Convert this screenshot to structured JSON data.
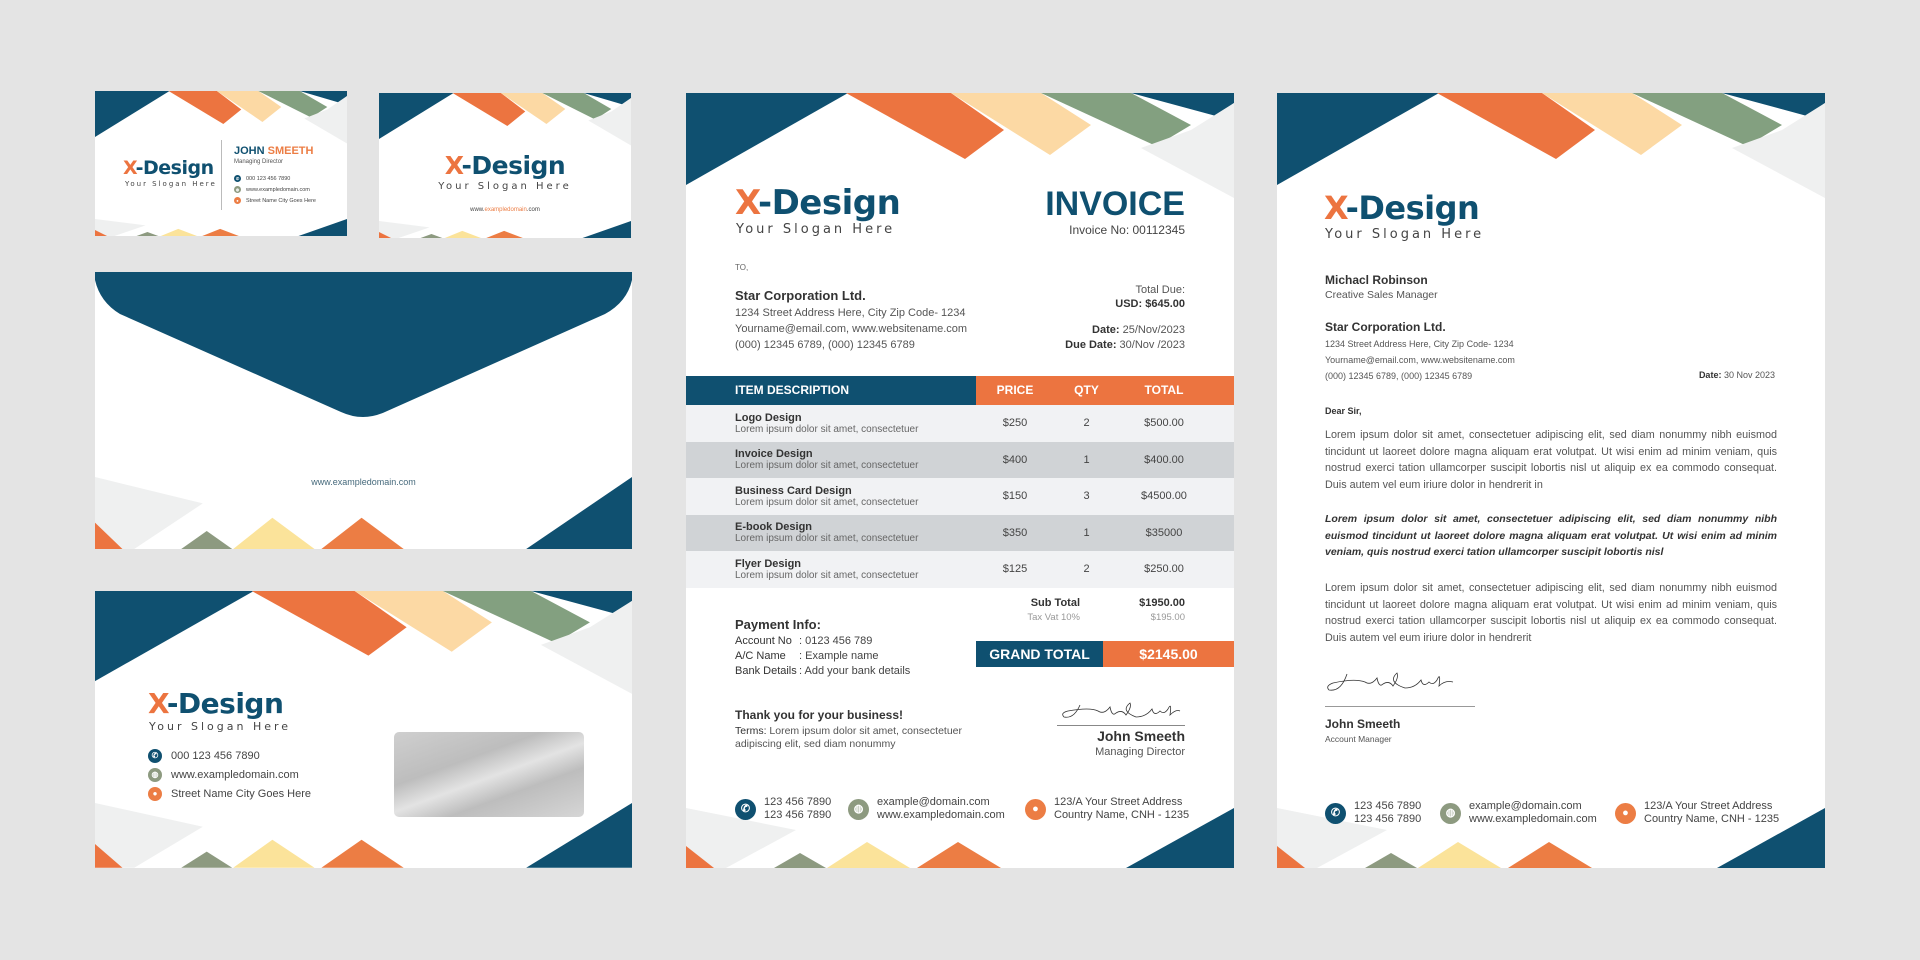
{
  "brand": {
    "logo_prefix": "X",
    "logo_rest": "-Design",
    "slogan": "Your Slogan Here",
    "colors": {
      "navy": "#0f5070",
      "orange": "#ec7440",
      "peach": "#fcd9a4",
      "sage": "#83a080",
      "light_gray": "#eff0f0",
      "yellow": "#fbe39a"
    }
  },
  "business_card_front": {
    "first_name": "JOHN",
    "last_name": "SMEETH",
    "role": "Managing Director",
    "contacts": [
      {
        "icon": "phone-icon",
        "text": "000 123 456 7890"
      },
      {
        "icon": "globe-icon",
        "text": "www.exampledomain.com"
      },
      {
        "icon": "location-pin-icon",
        "text": "Street Name City Goes Here"
      }
    ]
  },
  "business_card_back": {
    "web_prefix": "www.",
    "web_domain": "exampledomain",
    "web_suffix": ".com"
  },
  "envelope_back": {
    "website": "www.exampledomain.com"
  },
  "envelope_front": {
    "contacts": [
      {
        "icon": "phone-icon",
        "text": "000 123 456 7890"
      },
      {
        "icon": "globe-icon",
        "text": "www.exampledomain.com"
      },
      {
        "icon": "location-pin-icon",
        "text": "Street Name City Goes Here"
      }
    ]
  },
  "invoice": {
    "title": "INVOICE",
    "invoice_no": "Invoice No: 00112345",
    "to_label": "TO,",
    "bill_to": {
      "name": "Star Corporation Ltd.",
      "lines": [
        "1234 Street Address Here, City Zip Code- 1234",
        "Yourname@email.com, www.websitename.com",
        "(000) 12345 6789, (000) 12345 6789"
      ]
    },
    "total_due_label": "Total Due:",
    "total_due_value": "USD: $645.00",
    "date_label": "Date:",
    "date_value": " 25/Nov/2023",
    "due_date_label": "Due Date:",
    "due_date_value": " 30/Nov /2023",
    "table": {
      "headers": {
        "description": "ITEM DESCRIPTION",
        "price": "PRICE",
        "qty": "QTY",
        "total": "TOTAL"
      },
      "rows": [
        {
          "title": "Logo Design",
          "subtitle": "Lorem ipsum dolor sit amet, consectetuer",
          "price": "$250",
          "qty": "2",
          "total": "$500.00"
        },
        {
          "title": "Invoice Design",
          "subtitle": "Lorem ipsum dolor sit amet, consectetuer",
          "price": "$400",
          "qty": "1",
          "total": "$400.00"
        },
        {
          "title": "Business Card Design",
          "subtitle": "Lorem ipsum dolor sit amet, consectetuer",
          "price": "$150",
          "qty": "3",
          "total": "$4500.00"
        },
        {
          "title": "E-book Design",
          "subtitle": "Lorem ipsum dolor sit amet, consectetuer",
          "price": "$350",
          "qty": "1",
          "total": "$35000"
        },
        {
          "title": "Flyer Design",
          "subtitle": "Lorem ipsum dolor sit amet, consectetuer",
          "price": "$125",
          "qty": "2",
          "total": "$250.00"
        }
      ]
    },
    "sub_total_label": "Sub Total",
    "sub_total_value": "$1950.00",
    "tax_label": "Tax Vat 10%",
    "tax_value": "$195.00",
    "grand_total_label": "GRAND  TOTAL",
    "grand_total_value": "$2145.00",
    "payment": {
      "title": "Payment Info:",
      "rows": [
        {
          "key": "Account No",
          "value": " : 0123 456 789"
        },
        {
          "key": "A/C Name",
          "value": "    : Example name"
        },
        {
          "key": "Bank Details",
          "value": " : Add your bank details"
        }
      ]
    },
    "thanks": "Thank you for your business!",
    "terms_label": "Terms:",
    "terms_text": " Lorem ipsum dolor sit amet, consectetuer adipiscing elit, sed diam nonummy",
    "signer_name": "John Smeeth",
    "signer_role": "Managing Director",
    "footer": [
      {
        "icon": "phone-icon",
        "lines": [
          "123 456 7890",
          "123 456 7890"
        ]
      },
      {
        "icon": "globe-icon",
        "lines": [
          "example@domain.com",
          "www.exampledomain.com"
        ]
      },
      {
        "icon": "location-pin-icon",
        "lines": [
          "123/A  Your Street Address",
          "Country Name, CNH - 1235"
        ]
      }
    ]
  },
  "letterhead": {
    "recipient_name": "Michacl Robinson",
    "recipient_role": "Creative  Sales Manager",
    "company_name": "Star Corporation Ltd.",
    "company_lines": [
      "1234 Street Address Here, City Zip Code- 1234",
      "Yourname@email.com, www.websitename.com",
      "(000) 12345 6789, (000) 12345 6789"
    ],
    "date_label": "Date:",
    "date_value": " 30 Nov 2023",
    "greeting": "Dear Sir,",
    "paragraphs": [
      "Lorem ipsum dolor sit amet, consectetuer adipiscing elit, sed diam nonummy nibh euismod tincidunt ut laoreet dolore magna aliquam erat volutpat. Ut wisi enim ad minim veniam, quis nostrud exerci tation ullamcorper suscipit lobortis nisl ut aliquip ex ea commodo consequat. Duis autem vel eum iriure dolor in hendrerit in",
      "Lorem ipsum dolor sit amet, consectetuer adipiscing elit, sed diam nonummy nibh euismod tincidunt ut laoreet dolore magna aliquam erat volutpat. Ut wisi enim ad minim veniam, quis nostrud exerci tation ullamcorper suscipit lobortis nisl",
      "Lorem ipsum dolor sit amet, consectetuer adipiscing elit, sed diam nonummy nibh euismod tincidunt ut laoreet dolore magna aliquam erat volutpat. Ut wisi enim ad minim veniam, quis nostrud exerci tation ullamcorper suscipit lobortis nisl ut aliquip ex ea commodo consequat. Duis autem vel eum iriure dolor in hendrerit"
    ],
    "signer_name": "John Smeeth",
    "signer_role": "Account Manager",
    "footer": [
      {
        "icon": "phone-icon",
        "lines": [
          "123 456 7890",
          "123 456 7890"
        ]
      },
      {
        "icon": "globe-icon",
        "lines": [
          "example@domain.com",
          "www.exampledomain.com"
        ]
      },
      {
        "icon": "location-pin-icon",
        "lines": [
          "123/A  Your Street Address",
          "Country Name, CNH - 1235"
        ]
      }
    ]
  }
}
